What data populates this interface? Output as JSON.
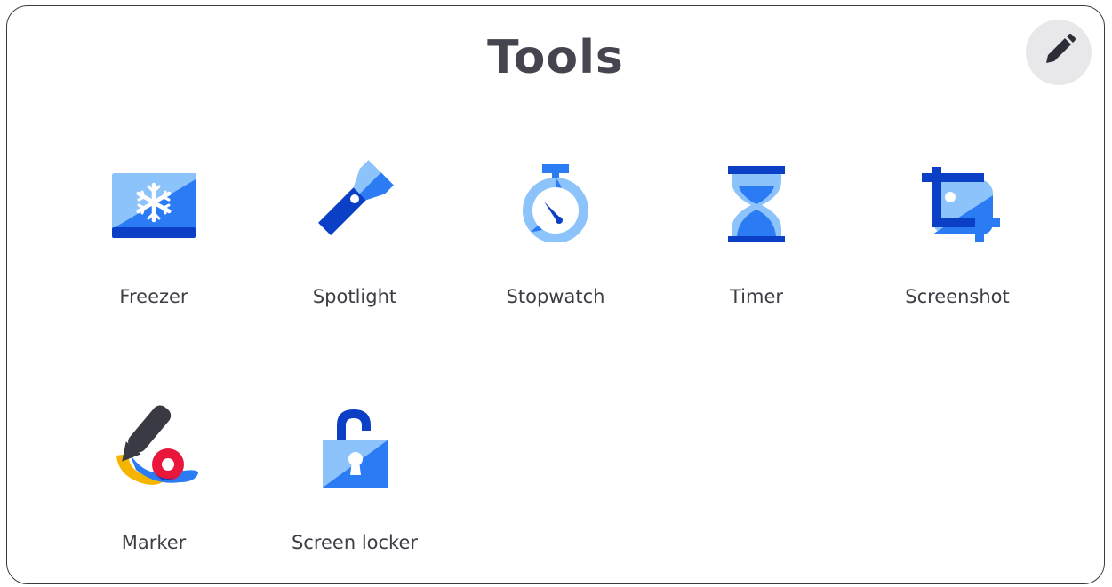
{
  "header": {
    "title": "Tools",
    "edit_icon": "pencil-icon"
  },
  "tools": [
    {
      "label": "Freezer",
      "icon": "snowflake-icon"
    },
    {
      "label": "Spotlight",
      "icon": "flashlight-icon"
    },
    {
      "label": "Stopwatch",
      "icon": "stopwatch-icon"
    },
    {
      "label": "Timer",
      "icon": "hourglass-icon"
    },
    {
      "label": "Screenshot",
      "icon": "crop-icon"
    },
    {
      "label": "Marker",
      "icon": "marker-icon"
    },
    {
      "label": "Screen locker",
      "icon": "padlock-icon"
    }
  ],
  "colors": {
    "dark_blue": "#0b3fc6",
    "mid_blue": "#2b7bf5",
    "light_blue": "#8cc3fb",
    "title_gray": "#454550",
    "marker_yellow": "#f5b400",
    "marker_red": "#e8173b"
  }
}
